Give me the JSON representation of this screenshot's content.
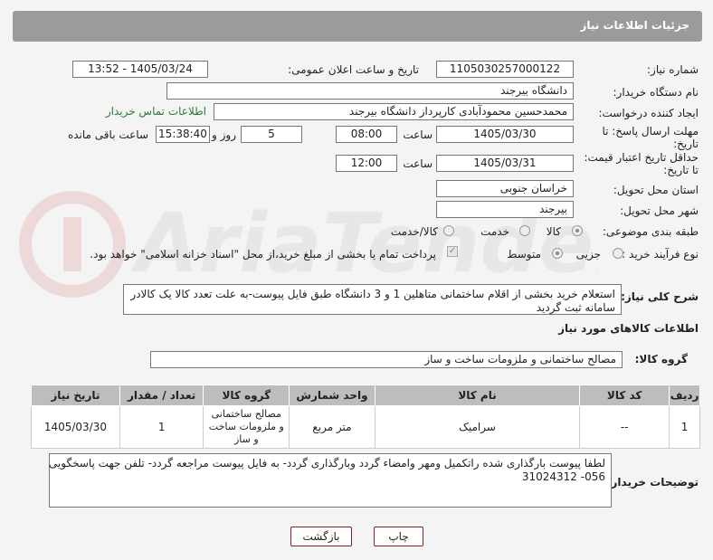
{
  "header": {
    "title": "جزئیات اطلاعات نیاز"
  },
  "form": {
    "need_number": {
      "label": "شماره نیاز:",
      "value": "1105030257000122"
    },
    "announce_datetime": {
      "label": "تاریخ و ساعت اعلان عمومی:",
      "value": "1405/03/24 - 13:52"
    },
    "buyer_org": {
      "label": "نام دستگاه خریدار:",
      "value": "دانشگاه بیرجند"
    },
    "requester": {
      "label": "ایجاد کننده درخواست:",
      "value": "محمدحسین محمودآبادی کارپرداز دانشگاه بیرجند",
      "contact_link": "اطلاعات تماس خریدار"
    },
    "reply_deadline": {
      "label_line1": "مهلت ارسال پاسخ: تا",
      "label_line2": "تاریخ:",
      "date": "1405/03/30",
      "time_label": "ساعت",
      "time": "08:00",
      "days": "5",
      "days_label": "روز و",
      "remaining": "15:38:40",
      "remaining_label": "ساعت باقی مانده"
    },
    "price_validity": {
      "label_line1": "حداقل تاریخ اعتبار قیمت:",
      "label_line2": "تا تاریخ:",
      "date": "1405/03/31",
      "time_label": "ساعت",
      "time": "12:00"
    },
    "delivery_province": {
      "label": "استان محل تحویل:",
      "value": "خراسان جنوبی"
    },
    "delivery_city": {
      "label": "شهر محل تحویل:",
      "value": "بیرجند"
    },
    "category": {
      "label": "طبقه بندی موضوعی:",
      "options": [
        "کالا",
        "خدمت",
        "کالا/خدمت"
      ],
      "selected": "کالا"
    },
    "process": {
      "label": "نوع فرآیند خرید :",
      "options": [
        "جزیی",
        "متوسط"
      ],
      "selected": "متوسط",
      "payment_note": "پرداخت تمام یا بخشی از مبلغ خرید،از محل \"اسناد خزانه اسلامی\" خواهد بود."
    }
  },
  "description": {
    "label": "شرح کلی نیاز:",
    "text": "استعلام خرید بخشی از اقلام ساختمانی متاهلین 1 و 3 دانشگاه طبق فایل پیوست-به علت تعدد کالا یک کالادر سامانه ثبت گردید"
  },
  "goods_section": {
    "title": "اطلاعات کالاهای مورد نیاز"
  },
  "goods_group": {
    "label": "گروه کالا:",
    "value": "مصالح ساختمانی و ملزومات ساخت و ساز"
  },
  "table": {
    "headers": [
      "ردیف",
      "کد کالا",
      "نام کالا",
      "واحد شمارش",
      "گروه کالا",
      "تعداد / مقدار",
      "تاریخ نیاز"
    ],
    "rows": [
      {
        "row": "1",
        "code": "--",
        "name": "سرامیک",
        "unit": "متر مربع",
        "group": "مصالح ساختمانی و ملزومات ساخت و ساز",
        "qty": "1",
        "date": "1405/03/30"
      }
    ]
  },
  "buyer_notes": {
    "label": "توضیحات خریدار:",
    "text_line1": "لطفا پیوست بارگذاری شده راتکمیل ومهر وامضاء گردد وبارگذاری گردد- به فایل پیوست مراجعه گردد-  تلفن جهت پاسخگویی",
    "text_line2": "056- 31024312"
  },
  "buttons": {
    "print": "چاپ",
    "back": "بازگشت"
  },
  "watermark": {
    "text": "AriaTender.net"
  },
  "colors": {
    "header_bg": "#9b9b9b",
    "link": "#2a7a3a",
    "button_border": "#8a1d1d",
    "table_header": "#bdbdbd"
  }
}
